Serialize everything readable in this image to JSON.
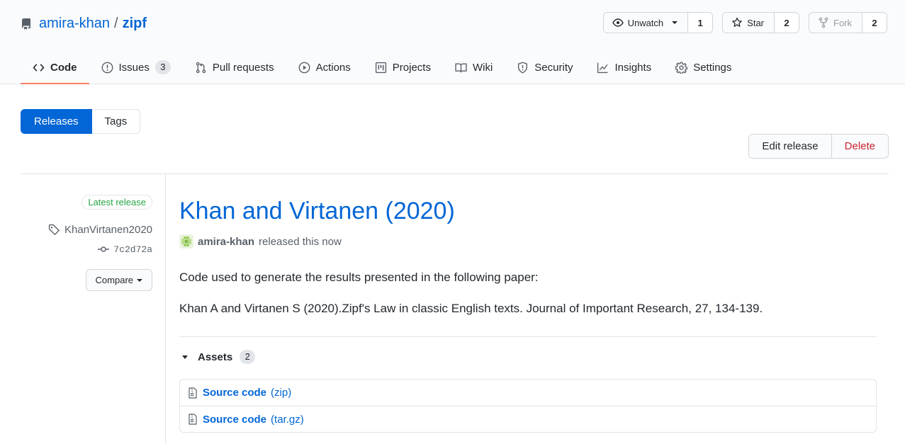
{
  "repo": {
    "owner": "amira-khan",
    "separator": "/",
    "name": "zipf"
  },
  "actions": {
    "watch": {
      "label": "Unwatch",
      "count": "1"
    },
    "star": {
      "label": "Star",
      "count": "2"
    },
    "fork": {
      "label": "Fork",
      "count": "2"
    }
  },
  "tabs": [
    {
      "label": "Code",
      "icon": "code-icon",
      "selected": true
    },
    {
      "label": "Issues",
      "icon": "issue-icon",
      "counter": "3"
    },
    {
      "label": "Pull requests",
      "icon": "pull-request-icon"
    },
    {
      "label": "Actions",
      "icon": "play-icon"
    },
    {
      "label": "Projects",
      "icon": "project-icon"
    },
    {
      "label": "Wiki",
      "icon": "book-icon"
    },
    {
      "label": "Security",
      "icon": "shield-icon"
    },
    {
      "label": "Insights",
      "icon": "graph-icon"
    },
    {
      "label": "Settings",
      "icon": "gear-icon"
    }
  ],
  "subnav": {
    "releases": "Releases",
    "tags": "Tags"
  },
  "release_actions": {
    "edit": "Edit release",
    "delete": "Delete"
  },
  "release": {
    "badge": "Latest release",
    "tag": "KhanVirtanen2020",
    "commit": "7c2d72a",
    "compare": "Compare",
    "title": "Khan and Virtanen (2020)",
    "author": "amira-khan",
    "released": "released this now",
    "body": [
      "Code used to generate the results presented in the following paper:",
      "Khan A and Virtanen S (2020).Zipf's Law in classic English texts. Journal of Important Research, 27, 134-139."
    ],
    "assets_label": "Assets",
    "assets_count": "2",
    "assets": [
      {
        "name": "Source code",
        "ext": "(zip)"
      },
      {
        "name": "Source code",
        "ext": "(tar.gz)"
      }
    ]
  },
  "colors": {
    "link": "#0366d6",
    "selected_tab": "#f9826c",
    "primary": "#0366d6",
    "danger": "#cb2431",
    "success": "#28a745"
  }
}
